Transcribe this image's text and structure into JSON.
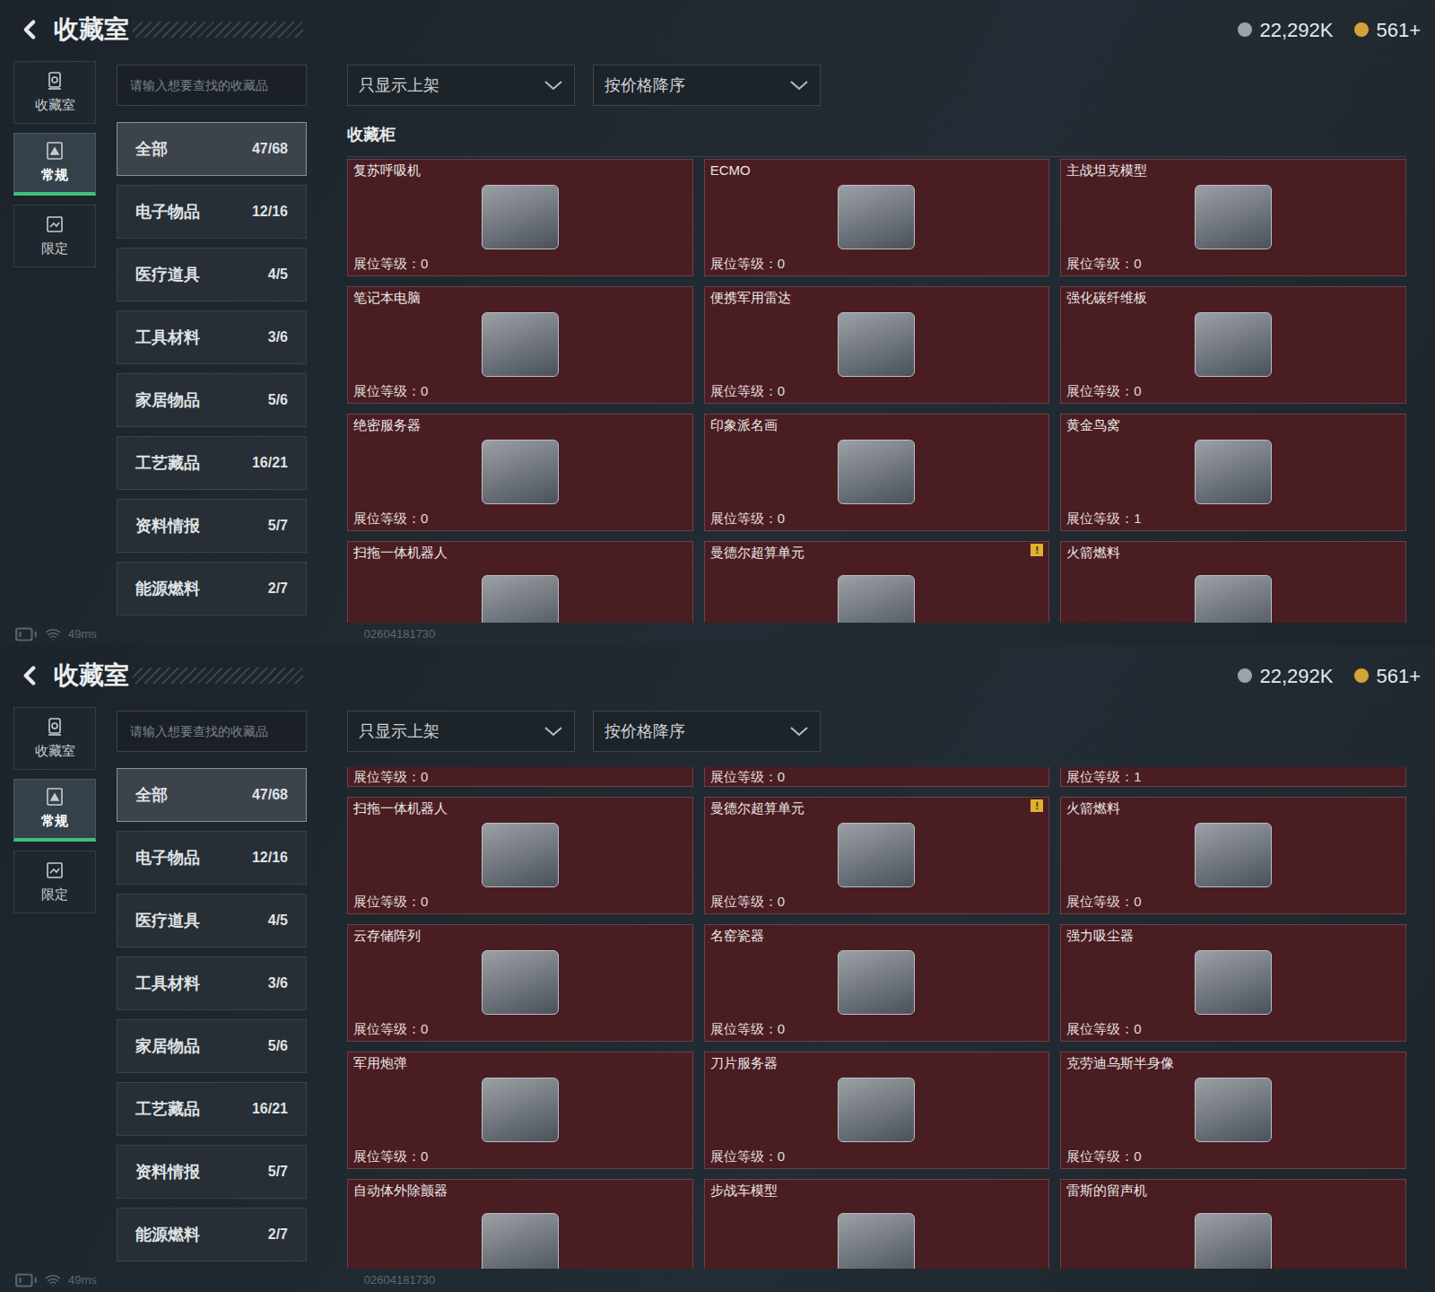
{
  "screens": [
    {
      "header": {
        "title": "收藏室",
        "currencies": [
          {
            "amount": "22,292K",
            "color": "#9aa3ad"
          },
          {
            "amount": "561+",
            "color": "#d4a23a"
          }
        ]
      },
      "nav": [
        {
          "label": "收藏室",
          "selected": false
        },
        {
          "label": "常规",
          "selected": true
        },
        {
          "label": "限定",
          "selected": false
        }
      ],
      "search": {
        "placeholder": "请输入想要查找的收藏品"
      },
      "filters": [
        {
          "label": "只显示上架"
        },
        {
          "label": "按价格降序"
        }
      ],
      "categories": [
        {
          "label": "全部",
          "count": "47/68",
          "selected": true
        },
        {
          "label": "电子物品",
          "count": "12/16",
          "selected": false
        },
        {
          "label": "医疗道具",
          "count": "4/5",
          "selected": false
        },
        {
          "label": "工具材料",
          "count": "3/6",
          "selected": false
        },
        {
          "label": "家居物品",
          "count": "5/6",
          "selected": false
        },
        {
          "label": "工艺藏品",
          "count": "16/21",
          "selected": false
        },
        {
          "label": "资料情报",
          "count": "5/7",
          "selected": false
        },
        {
          "label": "能源燃料",
          "count": "2/7",
          "selected": false
        }
      ],
      "section_title": "收藏柜",
      "items": [
        {
          "kind": "full",
          "name": "复苏呼吸机",
          "level": "展位等级：0"
        },
        {
          "kind": "full",
          "name": "ECMO",
          "level": "展位等级：0"
        },
        {
          "kind": "full",
          "name": "主战坦克模型",
          "level": "展位等级：0"
        },
        {
          "kind": "full",
          "name": "笔记本电脑",
          "level": "展位等级：0"
        },
        {
          "kind": "full",
          "name": "便携军用雷达",
          "level": "展位等级：0"
        },
        {
          "kind": "full",
          "name": "强化碳纤维板",
          "level": "展位等级：0"
        },
        {
          "kind": "full",
          "name": "绝密服务器",
          "level": "展位等级：0"
        },
        {
          "kind": "full",
          "name": "印象派名画",
          "level": "展位等级：0"
        },
        {
          "kind": "full",
          "name": "黄金鸟窝",
          "level": "展位等级：1"
        },
        {
          "kind": "bottom-cut",
          "name": "扫拖一体机器人"
        },
        {
          "kind": "bottom-cut",
          "name": "曼德尔超算单元",
          "badge": "!"
        },
        {
          "kind": "bottom-cut",
          "name": "火箭燃料"
        }
      ],
      "status": {
        "ping": "49ms",
        "id": "02604181730"
      }
    },
    {
      "header": {
        "title": "收藏室",
        "currencies": [
          {
            "amount": "22,292K",
            "color": "#9aa3ad"
          },
          {
            "amount": "561+",
            "color": "#d4a23a"
          }
        ]
      },
      "nav": [
        {
          "label": "收藏室",
          "selected": false
        },
        {
          "label": "常规",
          "selected": true
        },
        {
          "label": "限定",
          "selected": false
        }
      ],
      "search": {
        "placeholder": "请输入想要查找的收藏品"
      },
      "filters": [
        {
          "label": "只显示上架"
        },
        {
          "label": "按价格降序"
        }
      ],
      "categories": [
        {
          "label": "全部",
          "count": "47/68",
          "selected": true
        },
        {
          "label": "电子物品",
          "count": "12/16",
          "selected": false
        },
        {
          "label": "医疗道具",
          "count": "4/5",
          "selected": false
        },
        {
          "label": "工具材料",
          "count": "3/6",
          "selected": false
        },
        {
          "label": "家居物品",
          "count": "5/6",
          "selected": false
        },
        {
          "label": "工艺藏品",
          "count": "16/21",
          "selected": false
        },
        {
          "label": "资料情报",
          "count": "5/7",
          "selected": false
        },
        {
          "label": "能源燃料",
          "count": "2/7",
          "selected": false
        }
      ],
      "items": [
        {
          "kind": "top-cut",
          "level": "展位等级：0"
        },
        {
          "kind": "top-cut",
          "level": "展位等级：0"
        },
        {
          "kind": "top-cut",
          "level": "展位等级：1"
        },
        {
          "kind": "full",
          "name": "扫拖一体机器人",
          "level": "展位等级：0"
        },
        {
          "kind": "full",
          "name": "曼德尔超算单元",
          "level": "展位等级：0",
          "badge": "!"
        },
        {
          "kind": "full",
          "name": "火箭燃料",
          "level": "展位等级：0"
        },
        {
          "kind": "full",
          "name": "云存储阵列",
          "level": "展位等级：0"
        },
        {
          "kind": "full",
          "name": "名窑瓷器",
          "level": "展位等级：0"
        },
        {
          "kind": "full",
          "name": "强力吸尘器",
          "level": "展位等级：0"
        },
        {
          "kind": "full",
          "name": "军用炮弹",
          "level": "展位等级：0"
        },
        {
          "kind": "full",
          "name": "刀片服务器",
          "level": "展位等级：0"
        },
        {
          "kind": "full",
          "name": "克劳迪乌斯半身像",
          "level": "展位等级：0"
        },
        {
          "kind": "bottom-cut",
          "name": "自动体外除颤器"
        },
        {
          "kind": "bottom-cut",
          "name": "步战车模型"
        },
        {
          "kind": "bottom-cut",
          "name": "雷斯的留声机"
        }
      ],
      "status": {
        "ping": "49ms",
        "id": "02604181730"
      }
    }
  ]
}
